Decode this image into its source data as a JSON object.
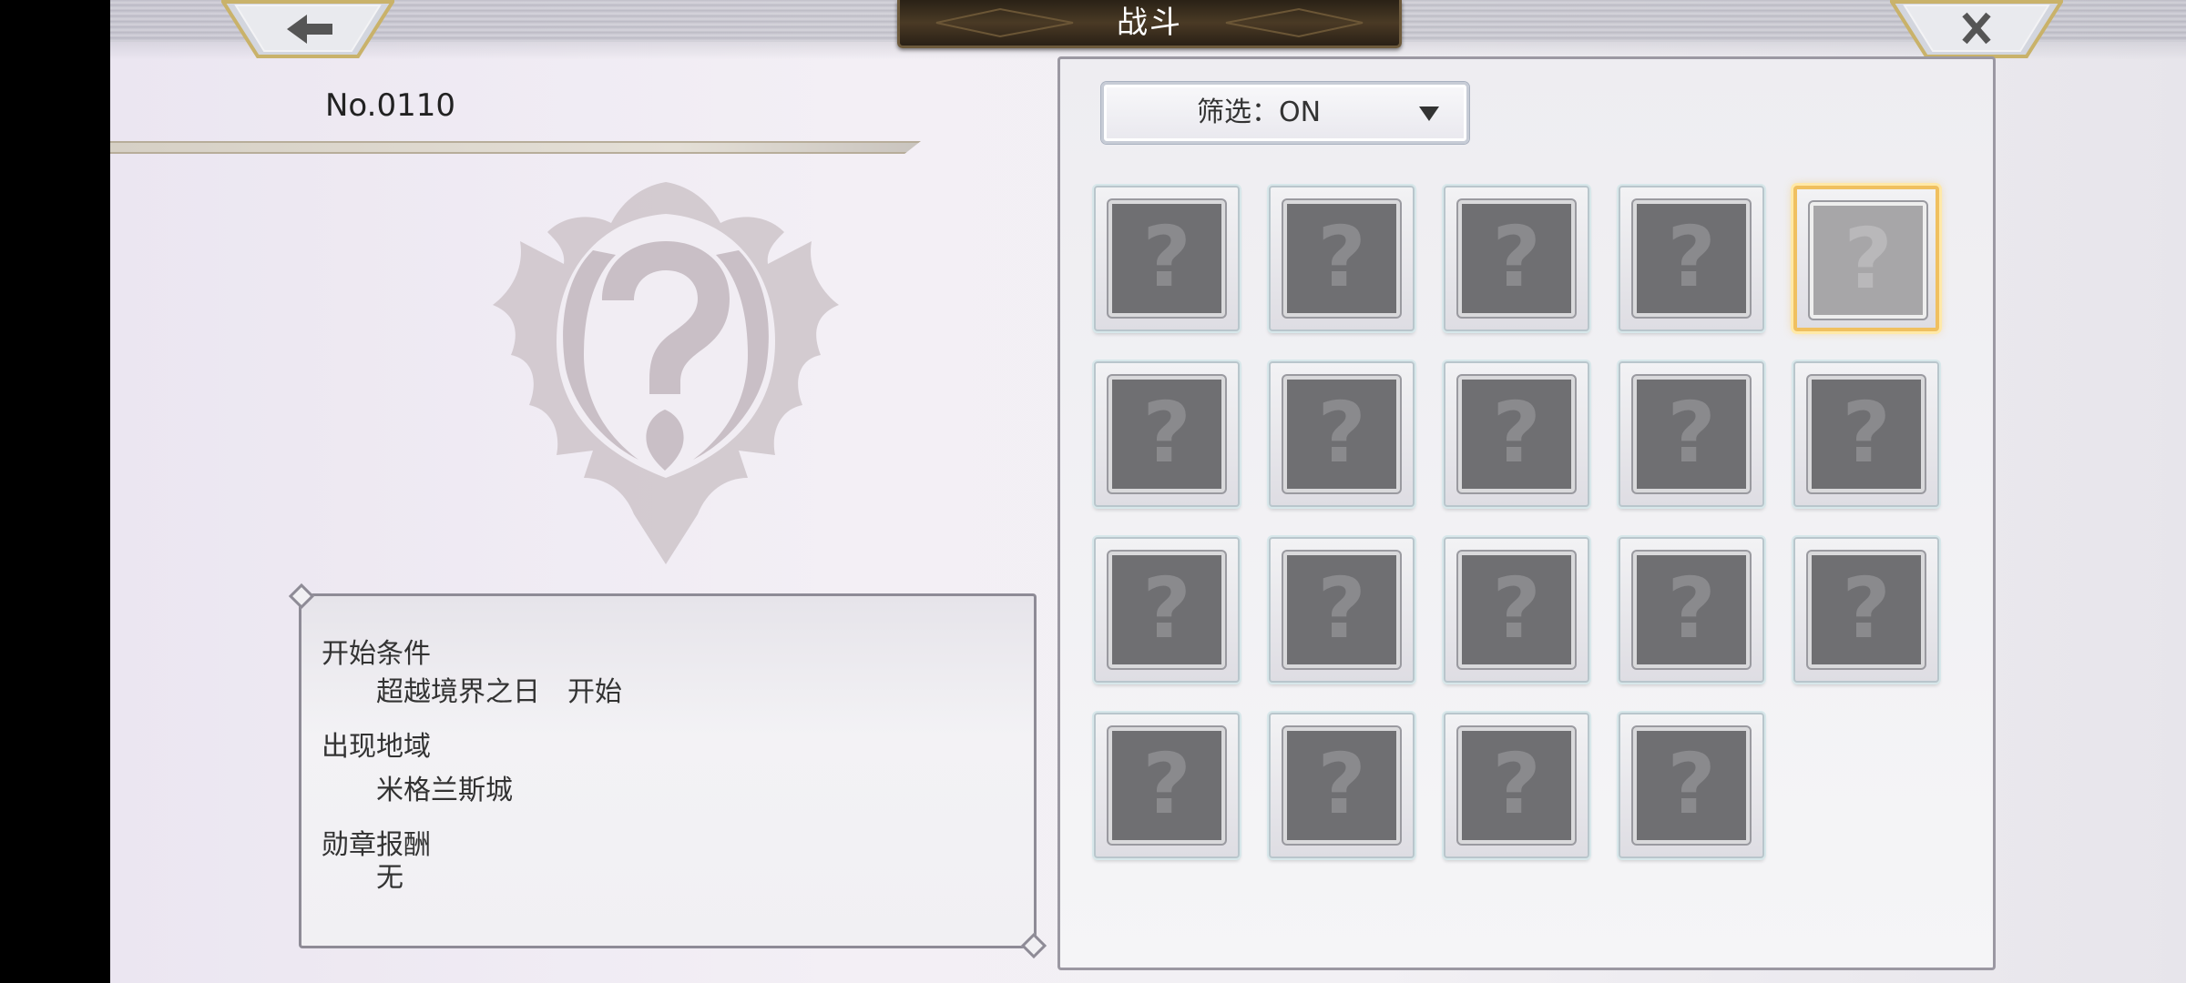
{
  "header": {
    "title": "战斗",
    "back_icon": "arrow-left-icon",
    "close_icon": "close-icon"
  },
  "entry": {
    "number": "No.0110",
    "emblem_icon": "unknown-question-emblem-icon",
    "details": [
      {
        "label": "开始条件",
        "value": "超越境界之日　开始"
      },
      {
        "label": "出现地域",
        "value": "米格兰斯城"
      },
      {
        "label": "勋章报酬",
        "value": "无"
      }
    ]
  },
  "filter": {
    "label": "筛选：ON",
    "arrow_icon": "dropdown-triangle-icon"
  },
  "slots": [
    {
      "glyph": "?",
      "selected": false
    },
    {
      "glyph": "?",
      "selected": false
    },
    {
      "glyph": "?",
      "selected": false
    },
    {
      "glyph": "?",
      "selected": false
    },
    {
      "glyph": "?",
      "selected": true
    },
    {
      "glyph": "?",
      "selected": false
    },
    {
      "glyph": "?",
      "selected": false
    },
    {
      "glyph": "?",
      "selected": false
    },
    {
      "glyph": "?",
      "selected": false
    },
    {
      "glyph": "?",
      "selected": false
    },
    {
      "glyph": "?",
      "selected": false
    },
    {
      "glyph": "?",
      "selected": false
    },
    {
      "glyph": "?",
      "selected": false
    },
    {
      "glyph": "?",
      "selected": false
    },
    {
      "glyph": "?",
      "selected": false
    },
    {
      "glyph": "?",
      "selected": false
    },
    {
      "glyph": "?",
      "selected": false
    },
    {
      "glyph": "?",
      "selected": false
    },
    {
      "glyph": "?",
      "selected": false
    }
  ]
}
